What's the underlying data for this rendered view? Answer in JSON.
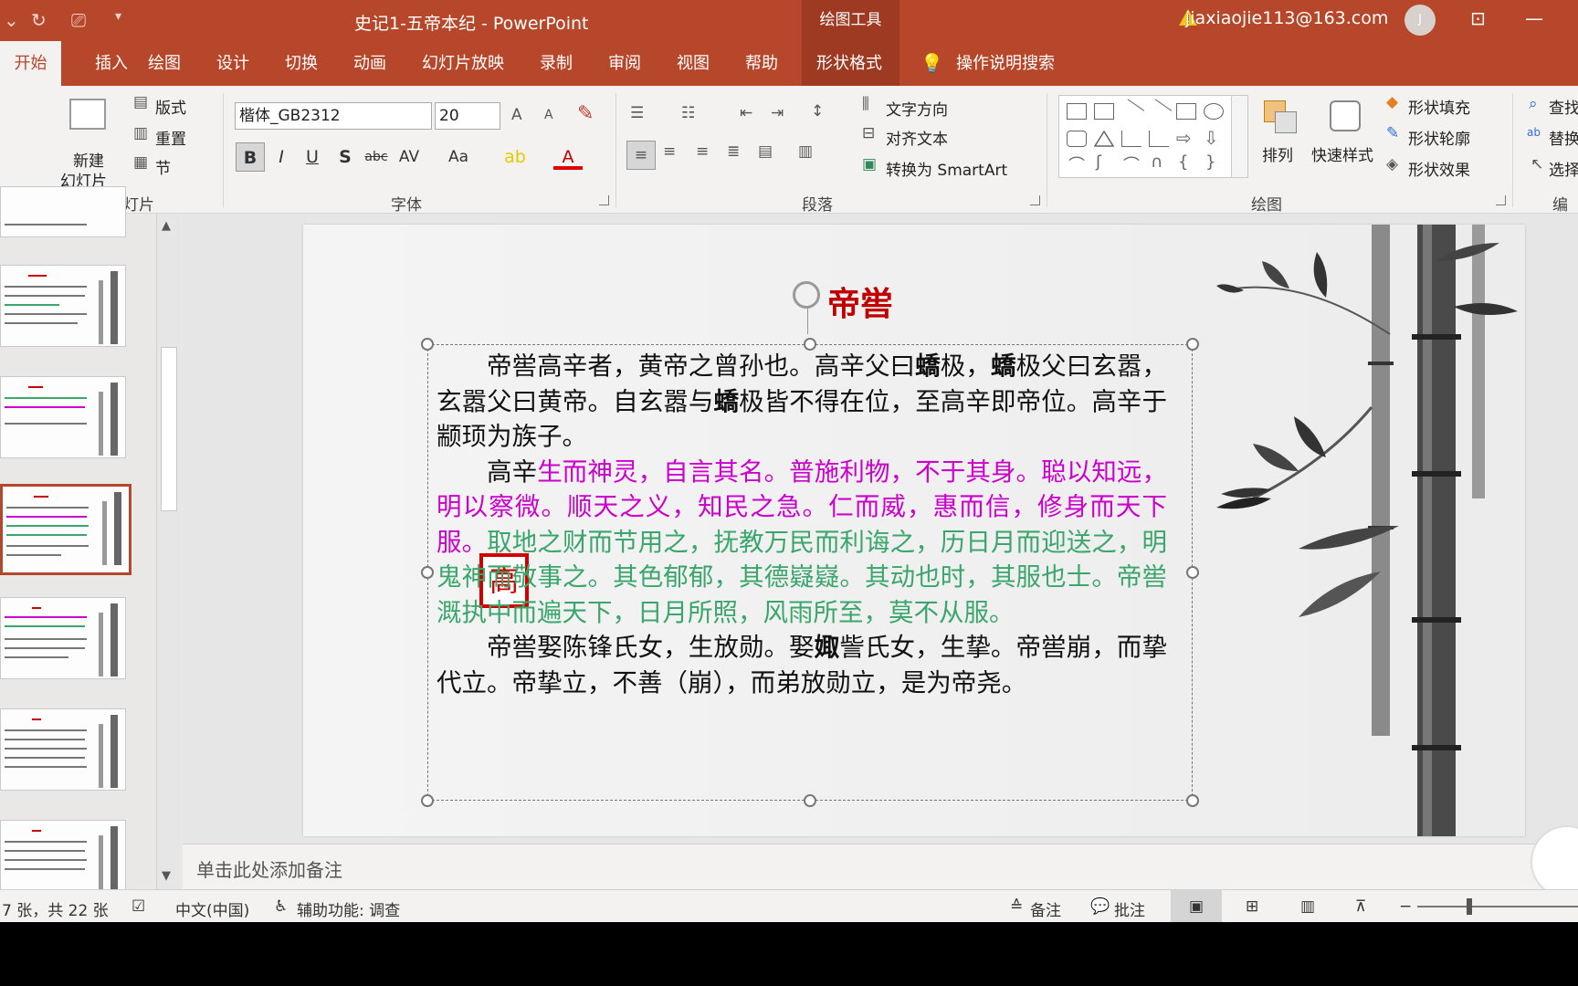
{
  "app": {
    "doc_title": "史记1-五帝本纪  -  PowerPoint",
    "tools_context": "绘图工具",
    "account": "jiaxiaojie113@163.com",
    "avatar_initial": "J"
  },
  "tabs": {
    "home": "开始",
    "insert": "插入",
    "draw": "绘图",
    "design": "设计",
    "transitions": "切换",
    "animations": "动画",
    "slideshow": "幻灯片放映",
    "record": "录制",
    "review": "审阅",
    "view": "视图",
    "help": "帮助",
    "shape_format": "形状格式",
    "tell_me": "操作说明搜索"
  },
  "ribbon": {
    "slides_group": {
      "label": "幻灯片",
      "new_slide_line1": "新建",
      "new_slide_line2": "幻灯片",
      "layout": "版式",
      "reset": "重置",
      "section": "节"
    },
    "font_group": {
      "label": "字体",
      "font_name": "楷体_GB2312",
      "font_size": "20",
      "bold": "B",
      "italic": "I",
      "underline": "U",
      "shadow": "S",
      "strike": "abc",
      "spacing": "AV",
      "case": "Aa",
      "grow": "A",
      "shrink": "A",
      "font_color": "A"
    },
    "paragraph_group": {
      "label": "段落",
      "text_direction": "文字方向",
      "align_text": "对齐文本",
      "smartart": "转换为 SmartArt"
    },
    "drawing_group": {
      "label": "绘图",
      "arrange": "排列",
      "quick_styles": "快速样式",
      "shape_fill": "形状填充",
      "shape_outline": "形状轮廓",
      "shape_effects": "形状效果"
    },
    "editing_group": {
      "label": "编辑",
      "find": "查找",
      "replace": "替换",
      "select": "选择"
    }
  },
  "slide": {
    "title": "帝喾",
    "seal_char": "高",
    "p1_a": "帝喾高辛者，黄帝之曾孙也。高辛父曰",
    "p1_b": "蟜",
    "p1_c": "极，",
    "p1_d": "蟜",
    "p1_e": "极父曰玄嚣，玄嚣父曰黄帝。自玄嚣与",
    "p1_f": "蟜",
    "p1_g": "极皆不得在位，至高辛即帝位。高辛于颛顼为族子。",
    "p2_a": "高辛",
    "p2_b": "生而神灵，自言其名。普施利物，不于其身。聪以知远，明以察微。顺天之义，知民之急。仁而威，惠而信，修身而天下服。",
    "p2_c": "取地之财而节用之，抚教万民而利诲之，历日月而迎送之，明鬼神而敬事之。其色郁郁，其德嶷嶷。其动也时，其服也士。帝喾溉执中而遍天下，日月所照，风雨所至，莫不从服。",
    "p3_a": "帝喾娶陈锋氏女，生放勋。娶",
    "p3_b": "娵",
    "p3_c": "訾氏女，生挚。帝喾崩，而挚代立。帝挚立，不善（崩），而弟放勋立，是为帝尧。"
  },
  "notes": {
    "placeholder": "单击此处添加备注"
  },
  "status": {
    "slide_info": "7 张，共 22 张",
    "language": "中文(中国)",
    "accessibility": "辅助功能: 调查",
    "notes_btn": "备注",
    "comments_btn": "批注"
  },
  "colors": {
    "accent": "#b7472a",
    "title_red": "#c00000",
    "magenta": "#cc00cc",
    "green": "#3aa66b"
  }
}
